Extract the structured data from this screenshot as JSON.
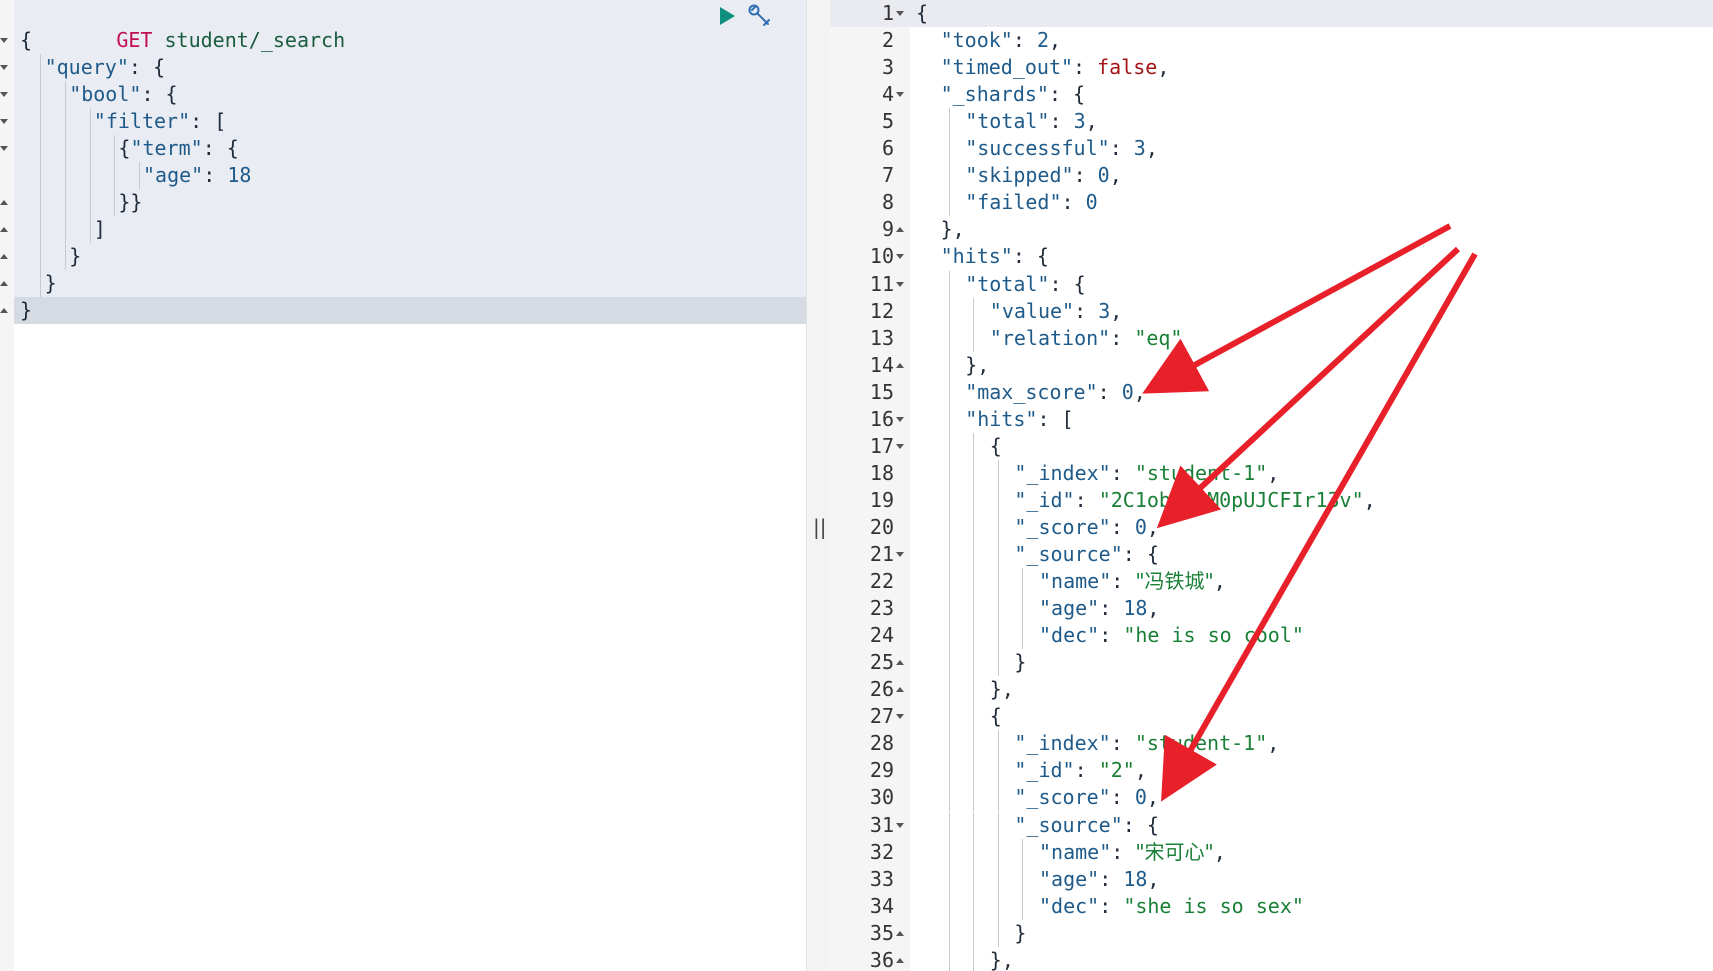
{
  "request": {
    "method": "GET",
    "path": "student/_search",
    "lines": [
      {
        "indent": 0,
        "fold": "open",
        "tokens": [
          {
            "t": "{",
            "c": "punc"
          }
        ]
      },
      {
        "indent": 1,
        "fold": "open",
        "tokens": [
          {
            "t": "\"query\"",
            "c": "key"
          },
          {
            "t": ": {",
            "c": "punc"
          }
        ]
      },
      {
        "indent": 2,
        "fold": "open",
        "tokens": [
          {
            "t": "\"bool\"",
            "c": "key"
          },
          {
            "t": ": {",
            "c": "punc"
          }
        ]
      },
      {
        "indent": 3,
        "fold": "open",
        "tokens": [
          {
            "t": "\"filter\"",
            "c": "key"
          },
          {
            "t": ": [",
            "c": "punc"
          }
        ]
      },
      {
        "indent": 4,
        "fold": "open",
        "tokens": [
          {
            "t": "{",
            "c": "punc"
          },
          {
            "t": "\"term\"",
            "c": "key"
          },
          {
            "t": ": {",
            "c": "punc"
          }
        ]
      },
      {
        "indent": 5,
        "fold": "",
        "tokens": [
          {
            "t": "\"age\"",
            "c": "key"
          },
          {
            "t": ": ",
            "c": "punc"
          },
          {
            "t": "18",
            "c": "num"
          }
        ]
      },
      {
        "indent": 4,
        "fold": "close",
        "tokens": [
          {
            "t": "}}",
            "c": "punc"
          }
        ]
      },
      {
        "indent": 3,
        "fold": "close",
        "tokens": [
          {
            "t": "]",
            "c": "punc"
          }
        ]
      },
      {
        "indent": 2,
        "fold": "close",
        "tokens": [
          {
            "t": "}",
            "c": "punc"
          }
        ]
      },
      {
        "indent": 1,
        "fold": "close",
        "tokens": [
          {
            "t": "}",
            "c": "punc"
          }
        ]
      },
      {
        "indent": 0,
        "fold": "close",
        "tokens": [
          {
            "t": "}",
            "c": "punc"
          }
        ]
      }
    ]
  },
  "toolbar": {
    "run_icon": "play-icon",
    "settings_icon": "wrench-icon",
    "divider_glyph": "||"
  },
  "response": {
    "lines": [
      {
        "n": "1",
        "fold": "open",
        "indent": 0,
        "tokens": [
          {
            "t": "{",
            "c": "punc"
          }
        ]
      },
      {
        "n": "2",
        "fold": "",
        "indent": 1,
        "tokens": [
          {
            "t": "\"took\"",
            "c": "key"
          },
          {
            "t": ": ",
            "c": "punc"
          },
          {
            "t": "2",
            "c": "num"
          },
          {
            "t": ",",
            "c": "punc"
          }
        ]
      },
      {
        "n": "3",
        "fold": "",
        "indent": 1,
        "tokens": [
          {
            "t": "\"timed_out\"",
            "c": "key"
          },
          {
            "t": ": ",
            "c": "punc"
          },
          {
            "t": "false",
            "c": "kw"
          },
          {
            "t": ",",
            "c": "punc"
          }
        ]
      },
      {
        "n": "4",
        "fold": "open",
        "indent": 1,
        "tokens": [
          {
            "t": "\"_shards\"",
            "c": "key"
          },
          {
            "t": ": {",
            "c": "punc"
          }
        ]
      },
      {
        "n": "5",
        "fold": "",
        "indent": 2,
        "tokens": [
          {
            "t": "\"total\"",
            "c": "key"
          },
          {
            "t": ": ",
            "c": "punc"
          },
          {
            "t": "3",
            "c": "num"
          },
          {
            "t": ",",
            "c": "punc"
          }
        ]
      },
      {
        "n": "6",
        "fold": "",
        "indent": 2,
        "tokens": [
          {
            "t": "\"successful\"",
            "c": "key"
          },
          {
            "t": ": ",
            "c": "punc"
          },
          {
            "t": "3",
            "c": "num"
          },
          {
            "t": ",",
            "c": "punc"
          }
        ]
      },
      {
        "n": "7",
        "fold": "",
        "indent": 2,
        "tokens": [
          {
            "t": "\"skipped\"",
            "c": "key"
          },
          {
            "t": ": ",
            "c": "punc"
          },
          {
            "t": "0",
            "c": "num"
          },
          {
            "t": ",",
            "c": "punc"
          }
        ]
      },
      {
        "n": "8",
        "fold": "",
        "indent": 2,
        "tokens": [
          {
            "t": "\"failed\"",
            "c": "key"
          },
          {
            "t": ": ",
            "c": "punc"
          },
          {
            "t": "0",
            "c": "num"
          }
        ]
      },
      {
        "n": "9",
        "fold": "close",
        "indent": 1,
        "tokens": [
          {
            "t": "},",
            "c": "punc"
          }
        ]
      },
      {
        "n": "10",
        "fold": "open",
        "indent": 1,
        "tokens": [
          {
            "t": "\"hits\"",
            "c": "key"
          },
          {
            "t": ": {",
            "c": "punc"
          }
        ]
      },
      {
        "n": "11",
        "fold": "open",
        "indent": 2,
        "tokens": [
          {
            "t": "\"total\"",
            "c": "key"
          },
          {
            "t": ": {",
            "c": "punc"
          }
        ]
      },
      {
        "n": "12",
        "fold": "",
        "indent": 3,
        "tokens": [
          {
            "t": "\"value\"",
            "c": "key"
          },
          {
            "t": ": ",
            "c": "punc"
          },
          {
            "t": "3",
            "c": "num"
          },
          {
            "t": ",",
            "c": "punc"
          }
        ]
      },
      {
        "n": "13",
        "fold": "",
        "indent": 3,
        "tokens": [
          {
            "t": "\"relation\"",
            "c": "key"
          },
          {
            "t": ": ",
            "c": "punc"
          },
          {
            "t": "\"eq\"",
            "c": "str"
          }
        ]
      },
      {
        "n": "14",
        "fold": "close",
        "indent": 2,
        "tokens": [
          {
            "t": "},",
            "c": "punc"
          }
        ]
      },
      {
        "n": "15",
        "fold": "",
        "indent": 2,
        "tokens": [
          {
            "t": "\"max_score\"",
            "c": "key"
          },
          {
            "t": ": ",
            "c": "punc"
          },
          {
            "t": "0",
            "c": "num"
          },
          {
            "t": ",",
            "c": "punc"
          }
        ]
      },
      {
        "n": "16",
        "fold": "open",
        "indent": 2,
        "tokens": [
          {
            "t": "\"hits\"",
            "c": "key"
          },
          {
            "t": ": [",
            "c": "punc"
          }
        ]
      },
      {
        "n": "17",
        "fold": "open",
        "indent": 3,
        "tokens": [
          {
            "t": "{",
            "c": "punc"
          }
        ]
      },
      {
        "n": "18",
        "fold": "",
        "indent": 4,
        "tokens": [
          {
            "t": "\"_index\"",
            "c": "key"
          },
          {
            "t": ": ",
            "c": "punc"
          },
          {
            "t": "\"student-1\"",
            "c": "str"
          },
          {
            "t": ",",
            "c": "punc"
          }
        ]
      },
      {
        "n": "19",
        "fold": "",
        "indent": 4,
        "tokens": [
          {
            "t": "\"_id\"",
            "c": "key"
          },
          {
            "t": ": ",
            "c": "punc"
          },
          {
            "t": "\"2C1obJIBM0pUJCFIr13v\"",
            "c": "str"
          },
          {
            "t": ",",
            "c": "punc"
          }
        ]
      },
      {
        "n": "20",
        "fold": "",
        "indent": 4,
        "tokens": [
          {
            "t": "\"_score\"",
            "c": "key"
          },
          {
            "t": ": ",
            "c": "punc"
          },
          {
            "t": "0",
            "c": "num"
          },
          {
            "t": ",",
            "c": "punc"
          }
        ]
      },
      {
        "n": "21",
        "fold": "open",
        "indent": 4,
        "tokens": [
          {
            "t": "\"_source\"",
            "c": "key"
          },
          {
            "t": ": {",
            "c": "punc"
          }
        ]
      },
      {
        "n": "22",
        "fold": "",
        "indent": 5,
        "tokens": [
          {
            "t": "\"name\"",
            "c": "key"
          },
          {
            "t": ": ",
            "c": "punc"
          },
          {
            "t": "\"冯铁城\"",
            "c": "str cjk"
          },
          {
            "t": ",",
            "c": "punc"
          }
        ]
      },
      {
        "n": "23",
        "fold": "",
        "indent": 5,
        "tokens": [
          {
            "t": "\"age\"",
            "c": "key"
          },
          {
            "t": ": ",
            "c": "punc"
          },
          {
            "t": "18",
            "c": "num"
          },
          {
            "t": ",",
            "c": "punc"
          }
        ]
      },
      {
        "n": "24",
        "fold": "",
        "indent": 5,
        "tokens": [
          {
            "t": "\"dec\"",
            "c": "key"
          },
          {
            "t": ": ",
            "c": "punc"
          },
          {
            "t": "\"he is so cool\"",
            "c": "str"
          }
        ]
      },
      {
        "n": "25",
        "fold": "close",
        "indent": 4,
        "tokens": [
          {
            "t": "}",
            "c": "punc"
          }
        ]
      },
      {
        "n": "26",
        "fold": "close",
        "indent": 3,
        "tokens": [
          {
            "t": "},",
            "c": "punc"
          }
        ]
      },
      {
        "n": "27",
        "fold": "open",
        "indent": 3,
        "tokens": [
          {
            "t": "{",
            "c": "punc"
          }
        ]
      },
      {
        "n": "28",
        "fold": "",
        "indent": 4,
        "tokens": [
          {
            "t": "\"_index\"",
            "c": "key"
          },
          {
            "t": ": ",
            "c": "punc"
          },
          {
            "t": "\"student-1\"",
            "c": "str"
          },
          {
            "t": ",",
            "c": "punc"
          }
        ]
      },
      {
        "n": "29",
        "fold": "",
        "indent": 4,
        "tokens": [
          {
            "t": "\"_id\"",
            "c": "key"
          },
          {
            "t": ": ",
            "c": "punc"
          },
          {
            "t": "\"2\"",
            "c": "str"
          },
          {
            "t": ",",
            "c": "punc"
          }
        ]
      },
      {
        "n": "30",
        "fold": "",
        "indent": 4,
        "tokens": [
          {
            "t": "\"_score\"",
            "c": "key"
          },
          {
            "t": ": ",
            "c": "punc"
          },
          {
            "t": "0",
            "c": "num"
          },
          {
            "t": ",",
            "c": "punc"
          }
        ]
      },
      {
        "n": "31",
        "fold": "open",
        "indent": 4,
        "tokens": [
          {
            "t": "\"_source\"",
            "c": "key"
          },
          {
            "t": ": {",
            "c": "punc"
          }
        ]
      },
      {
        "n": "32",
        "fold": "",
        "indent": 5,
        "tokens": [
          {
            "t": "\"name\"",
            "c": "key"
          },
          {
            "t": ": ",
            "c": "punc"
          },
          {
            "t": "\"宋可心\"",
            "c": "str cjk"
          },
          {
            "t": ",",
            "c": "punc"
          }
        ]
      },
      {
        "n": "33",
        "fold": "",
        "indent": 5,
        "tokens": [
          {
            "t": "\"age\"",
            "c": "key"
          },
          {
            "t": ": ",
            "c": "punc"
          },
          {
            "t": "18",
            "c": "num"
          },
          {
            "t": ",",
            "c": "punc"
          }
        ]
      },
      {
        "n": "34",
        "fold": "",
        "indent": 5,
        "tokens": [
          {
            "t": "\"dec\"",
            "c": "key"
          },
          {
            "t": ": ",
            "c": "punc"
          },
          {
            "t": "\"she is so sex\"",
            "c": "str"
          }
        ]
      },
      {
        "n": "35",
        "fold": "close",
        "indent": 4,
        "tokens": [
          {
            "t": "}",
            "c": "punc"
          }
        ]
      },
      {
        "n": "36",
        "fold": "close",
        "indent": 3,
        "tokens": [
          {
            "t": "},",
            "c": "punc"
          }
        ]
      }
    ]
  },
  "colors": {
    "method": "#c10e4f",
    "key": "#1f5b8a",
    "string": "#1a7f37",
    "keyword": "#a31515",
    "annotation_arrow": "#e8202a",
    "run_icon": "#0f8f7f"
  }
}
